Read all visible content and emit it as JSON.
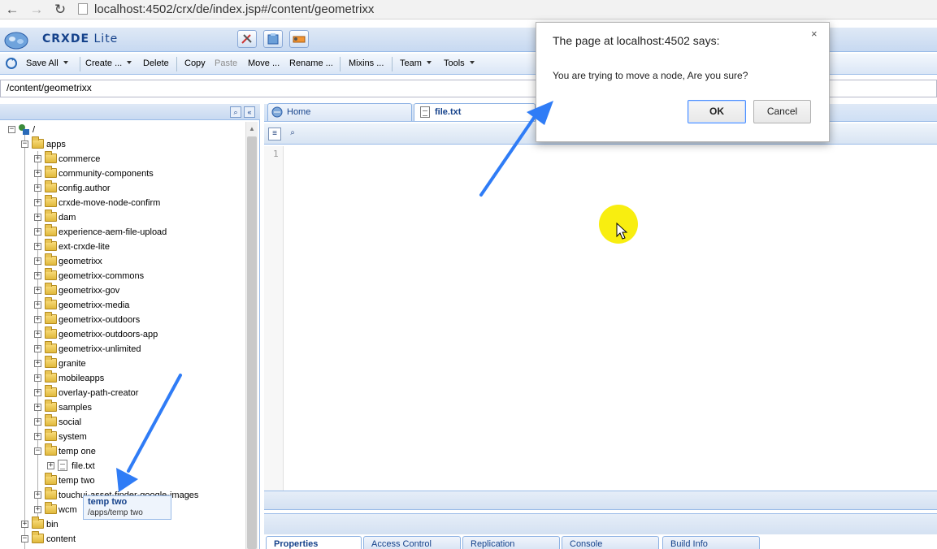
{
  "browser": {
    "url": "localhost:4502/crx/de/index.jsp#/content/geometrixx",
    "back_icon": "back-arrow-icon",
    "forward_icon": "forward-arrow-icon",
    "reload_icon": "reload-icon"
  },
  "app": {
    "title_bold": "CRXDE",
    "title_light": "Lite"
  },
  "toolbar": {
    "save_all": "Save All",
    "create": "Create ...",
    "delete": "Delete",
    "copy": "Copy",
    "paste": "Paste",
    "move": "Move ...",
    "rename": "Rename ...",
    "mixins": "Mixins ...",
    "team": "Team",
    "tools": "Tools"
  },
  "path": "/content/geometrixx",
  "tree": {
    "root": "/",
    "apps": "apps",
    "children": [
      "commerce",
      "community-components",
      "config.author",
      "crxde-move-node-confirm",
      "dam",
      "experience-aem-file-upload",
      "ext-crxde-lite",
      "geometrixx",
      "geometrixx-commons",
      "geometrixx-gov",
      "geometrixx-media",
      "geometrixx-outdoors",
      "geometrixx-outdoors-app",
      "geometrixx-unlimited",
      "granite",
      "mobileapps",
      "overlay-path-creator",
      "samples",
      "social",
      "system"
    ],
    "temp_one": "temp one",
    "file_txt": "file.txt",
    "temp_two": "temp two",
    "touchui": "touchui-asset-finder-google-images",
    "wcm": "wcm",
    "bin": "bin",
    "content": "content"
  },
  "tooltip": {
    "title": "temp two",
    "path": "/apps/temp two"
  },
  "tabs": {
    "home": "Home",
    "file": "file.txt"
  },
  "editor": {
    "line_number": "1"
  },
  "bottom_tabs": [
    "Properties",
    "Access Control",
    "Replication",
    "Console",
    "Build Info"
  ],
  "dialog": {
    "title": "The page at localhost:4502 says:",
    "message": "You are trying to move a node, Are you sure?",
    "ok": "OK",
    "cancel": "Cancel",
    "close": "×"
  },
  "colors": {
    "accent": "#15428b",
    "annotation_arrow": "#2f7cf6",
    "cursor_highlight": "#f8ee10"
  }
}
